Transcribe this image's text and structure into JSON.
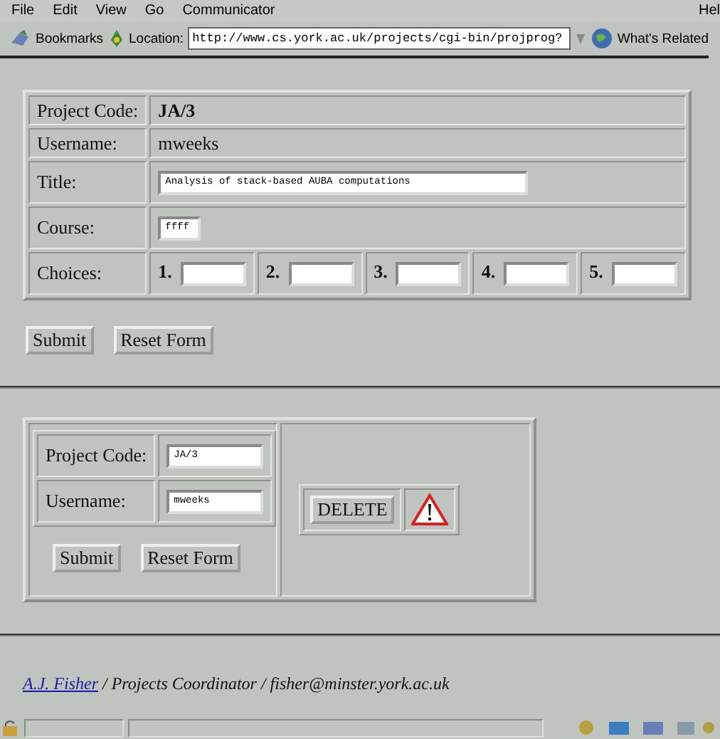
{
  "menu_bar": {
    "items": [
      "File",
      "Edit",
      "View",
      "Go",
      "Communicator"
    ],
    "help": "Hel"
  },
  "toolbar": {
    "bookmarks": "Bookmarks",
    "location_label": "Location:",
    "url": "http://www.cs.york.ac.uk/projects/cgi-bin/projprog?",
    "related": "What's Related"
  },
  "edit_form": {
    "rows": [
      {
        "kind": "bold_text",
        "label": "Project Code:",
        "value": "JA/3"
      },
      {
        "kind": "text",
        "label": "Username:",
        "value": "mweeks"
      },
      {
        "kind": "wide_field",
        "label": "Title:",
        "value": "Analysis of stack-based AUBA computations"
      },
      {
        "kind": "short_field",
        "label": "Course:",
        "value": "ffff"
      },
      {
        "kind": "choices",
        "label": "Choices:",
        "choices": [
          {
            "number": "1."
          },
          {
            "number": "2."
          },
          {
            "number": "3."
          },
          {
            "number": "4."
          },
          {
            "number": "5."
          }
        ]
      }
    ],
    "buttons": [
      "Submit",
      "Reset Form"
    ]
  },
  "delete_form": {
    "rows": [
      {
        "label": "Project Code:",
        "value": "JA/3"
      },
      {
        "label": "Username:",
        "value": "mweeks"
      }
    ],
    "buttons": [
      "Submit",
      "Reset Form"
    ],
    "delete_button": "DELETE"
  },
  "footer": {
    "link": "A.J. Fisher",
    "text": " / Projects Coordinator / fisher@minster.york.ac.uk"
  }
}
